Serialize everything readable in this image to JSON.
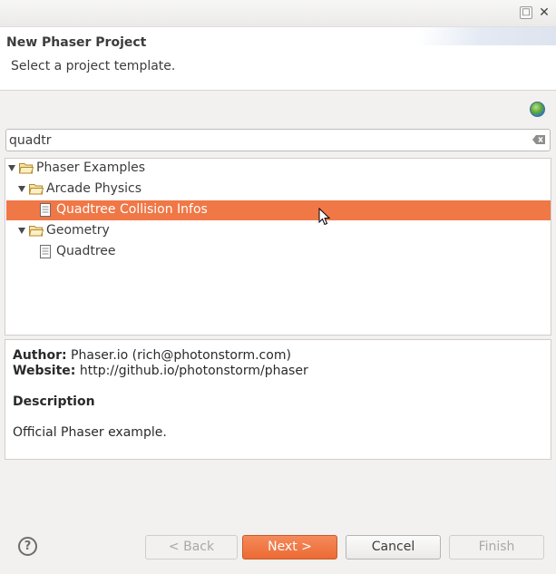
{
  "window": {
    "maximize_icon": "maximize-icon",
    "close_icon": "close-icon"
  },
  "header": {
    "title": "New Phaser Project",
    "subtitle": "Select a project template."
  },
  "search": {
    "value": "quadtr",
    "placeholder": ""
  },
  "tree": {
    "items": [
      {
        "label": "Phaser Examples",
        "type": "folder",
        "expanded": true
      },
      {
        "label": "Arcade Physics",
        "type": "folder",
        "expanded": true
      },
      {
        "label": "Quadtree Collision Infos",
        "type": "file",
        "selected": true
      },
      {
        "label": "Geometry",
        "type": "folder",
        "expanded": true
      },
      {
        "label": "Quadtree",
        "type": "file"
      }
    ]
  },
  "details": {
    "author_label": "Author:",
    "author_value": "Phaser.io (rich@photonstorm.com)",
    "website_label": "Website:",
    "website_value": "http://github.io/photonstorm/phaser",
    "description_heading": "Description",
    "description_text": "Official Phaser example."
  },
  "buttons": {
    "back": "< Back",
    "next": "Next >",
    "cancel": "Cancel",
    "finish": "Finish"
  },
  "colors": {
    "selection": "#f07746",
    "primary_button": "#ec6a34"
  }
}
